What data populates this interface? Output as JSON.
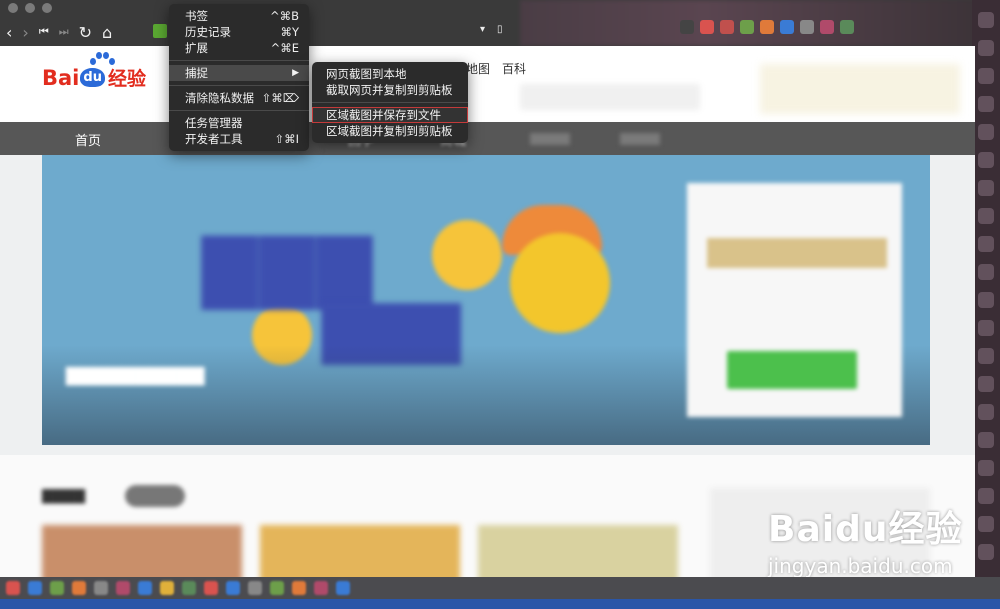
{
  "browser": {
    "back_label": "‹",
    "forward_label": "›",
    "skip_back_label": "⏮",
    "skip_fwd_label": "⏭",
    "reload_label": "↻",
    "home_label": "⌂",
    "dropdown_label": "▾",
    "bookmark_label": "▯"
  },
  "baidu": {
    "logo_bai": "Bai",
    "logo_du": "du",
    "logo_jingyan": "经验",
    "topnav": [
      "地图",
      "百科"
    ],
    "categories": [
      "首页",
      "回字",
      "商城"
    ]
  },
  "menu": {
    "items": [
      {
        "label": "书签",
        "shortcut": "^⌘B"
      },
      {
        "label": "历史记录",
        "shortcut": "⌘Y"
      },
      {
        "label": "扩展",
        "shortcut": "^⌘E"
      },
      {
        "label": "捕捉",
        "shortcut": "▶"
      },
      {
        "label": "清除隐私数据",
        "shortcut": "⇧⌘⌦"
      },
      {
        "label": "任务管理器",
        "shortcut": ""
      },
      {
        "label": "开发者工具",
        "shortcut": "⇧⌘I"
      }
    ],
    "submenu": [
      {
        "label": "网页截图到本地"
      },
      {
        "label": "截取网页并复制到剪贴板"
      },
      {
        "label": "区域截图并保存到文件"
      },
      {
        "label": "区域截图并复制到剪贴板"
      }
    ]
  },
  "watermark": {
    "main": "Baidu经验",
    "sub": "jingyan.baidu.com"
  },
  "colors": {
    "accent_red": "#e22d1f",
    "accent_blue": "#2b6ad8",
    "banner_bg": "#6eaacd",
    "menu_bg": "#2b2b2b",
    "highlight_outline": "#c43a3a"
  }
}
